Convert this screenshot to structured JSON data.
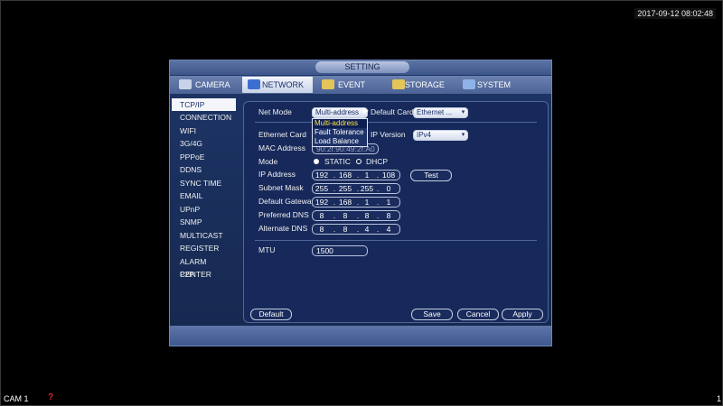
{
  "clock": "2017-09-12 08:02:48",
  "cam": {
    "label": "CAM 1",
    "alert": "?",
    "number": "1"
  },
  "dialog": {
    "title": "SETTING"
  },
  "tabs": [
    {
      "label": "CAMERA"
    },
    {
      "label": "NETWORK"
    },
    {
      "label": "EVENT"
    },
    {
      "label": "STORAGE"
    },
    {
      "label": "SYSTEM"
    }
  ],
  "sidebar": {
    "items": [
      "TCP/IP",
      "CONNECTION",
      "WIFI",
      "3G/4G",
      "PPPoE",
      "DDNS",
      "SYNC TIME",
      "EMAIL",
      "UPnP",
      "SNMP",
      "MULTICAST",
      "REGISTER",
      "ALARM CENTER",
      "P2P"
    ]
  },
  "form": {
    "net_mode_label": "Net Mode",
    "net_mode_value": "Multi-address",
    "net_mode_options": [
      "Multi-address",
      "Fault Tolerance",
      "Load Balance"
    ],
    "default_card_label": "Default Card",
    "default_card_value": "Ethernet ...",
    "ethernet_card_label": "Ethernet Card",
    "ip_version_label": "IP Version",
    "ip_version_value": "IPv4",
    "mac_label": "MAC Address",
    "mac_value": "90:2f:90:49:2f:A0",
    "mode_label": "Mode",
    "mode_static": "STATIC",
    "mode_dhcp": "DHCP",
    "ip_label": "IP Address",
    "ip_value": [
      "192",
      "168",
      "1",
      "108"
    ],
    "test_label": "Test",
    "mask_label": "Subnet Mask",
    "mask_value": [
      "255",
      "255",
      "255",
      "0"
    ],
    "gateway_label": "Default Gateway",
    "gateway_value": [
      "192",
      "168",
      "1",
      "1"
    ],
    "pdns_label": "Preferred DNS",
    "pdns_value": [
      "8",
      "8",
      "8",
      "8"
    ],
    "adns_label": "Alternate DNS",
    "adns_value": [
      "8",
      "8",
      "4",
      "4"
    ],
    "mtu_label": "MTU",
    "mtu_value": "1500"
  },
  "buttons": {
    "default": "Default",
    "save": "Save",
    "cancel": "Cancel",
    "apply": "Apply"
  },
  "colors": {
    "background": "#000000",
    "dialog": "#1e3566",
    "highlight": "#ffe44a"
  }
}
